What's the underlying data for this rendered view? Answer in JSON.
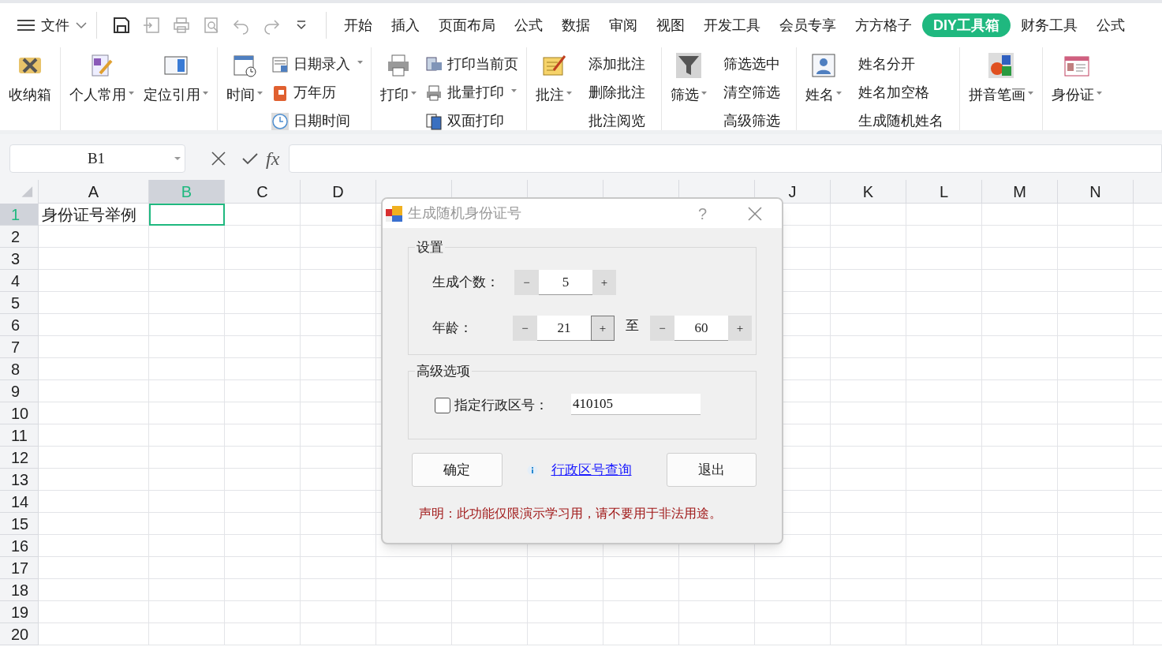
{
  "quick_bar": {
    "file_menu": "文件"
  },
  "menu_tabs": [
    {
      "label": "开始",
      "selected": false
    },
    {
      "label": "插入",
      "selected": false
    },
    {
      "label": "页面布局",
      "selected": false
    },
    {
      "label": "公式",
      "selected": false
    },
    {
      "label": "数据",
      "selected": false
    },
    {
      "label": "审阅",
      "selected": false
    },
    {
      "label": "视图",
      "selected": false
    },
    {
      "label": "开发工具",
      "selected": false
    },
    {
      "label": "会员专享",
      "selected": false
    },
    {
      "label": "方方格子",
      "selected": false
    },
    {
      "label": "DIY工具箱",
      "selected": true
    },
    {
      "label": "财务工具",
      "selected": false
    },
    {
      "label": "公式",
      "selected": false
    }
  ],
  "ribbon": {
    "groups": [
      {
        "items": [
          {
            "kind": "large",
            "label": "收纳箱",
            "dropdown": false
          }
        ]
      },
      {
        "items": [
          {
            "kind": "large",
            "label": "个人常用",
            "dropdown": true
          },
          {
            "kind": "large",
            "label": "定位引用",
            "dropdown": true
          }
        ]
      },
      {
        "items": [
          {
            "kind": "large",
            "label": "时间",
            "dropdown": true
          },
          {
            "kind": "small",
            "label": "日期录入",
            "dropdown": true
          },
          {
            "kind": "small",
            "label": "万年历",
            "dropdown": false
          },
          {
            "kind": "small",
            "label": "日期时间",
            "dropdown": false
          }
        ]
      },
      {
        "items": [
          {
            "kind": "large",
            "label": "打印",
            "dropdown": true
          },
          {
            "kind": "small",
            "label": "打印当前页",
            "dropdown": false
          },
          {
            "kind": "small",
            "label": "批量打印",
            "dropdown": true
          },
          {
            "kind": "small",
            "label": "双面打印",
            "dropdown": false
          }
        ]
      },
      {
        "items": [
          {
            "kind": "large",
            "label": "批注",
            "dropdown": true
          },
          {
            "kind": "text",
            "label": "添加批注",
            "dropdown": false
          },
          {
            "kind": "text",
            "label": "删除批注",
            "dropdown": false
          },
          {
            "kind": "text",
            "label": "批注阅览",
            "dropdown": false
          }
        ]
      },
      {
        "items": [
          {
            "kind": "large",
            "label": "筛选",
            "dropdown": true
          },
          {
            "kind": "text",
            "label": "筛选选中",
            "dropdown": false
          },
          {
            "kind": "text",
            "label": "清空筛选",
            "dropdown": false
          },
          {
            "kind": "text",
            "label": "高级筛选",
            "dropdown": false
          }
        ]
      },
      {
        "items": [
          {
            "kind": "large",
            "label": "姓名",
            "dropdown": true
          },
          {
            "kind": "text",
            "label": "姓名分开",
            "dropdown": false
          },
          {
            "kind": "text",
            "label": "姓名加空格",
            "dropdown": false
          },
          {
            "kind": "text",
            "label": "生成随机姓名",
            "dropdown": false
          }
        ]
      },
      {
        "items": [
          {
            "kind": "large",
            "label": "拼音笔画",
            "dropdown": true
          }
        ]
      },
      {
        "items": [
          {
            "kind": "large",
            "label": "身份证",
            "dropdown": true
          }
        ]
      }
    ]
  },
  "formula_bar": {
    "name_box": "B1",
    "fx": "fx"
  },
  "sheet": {
    "columns": [
      {
        "label": "A",
        "selected": false
      },
      {
        "label": "B",
        "selected": true
      },
      {
        "label": "C",
        "selected": false
      },
      {
        "label": "D",
        "selected": false
      },
      {},
      {},
      {},
      {},
      {},
      {
        "label": "J",
        "selected": false
      },
      {
        "label": "K",
        "selected": false
      },
      {
        "label": "L",
        "selected": false
      },
      {
        "label": "M",
        "selected": false
      },
      {
        "label": "N",
        "selected": false
      }
    ],
    "rows": [
      {
        "label": "1",
        "selected": true,
        "cells": [
          "身份证号举例"
        ]
      },
      {
        "label": "2",
        "selected": false
      },
      {
        "label": "3",
        "selected": false
      },
      {
        "label": "4",
        "selected": false
      },
      {
        "label": "5",
        "selected": false
      },
      {
        "label": "6",
        "selected": false
      },
      {
        "label": "7",
        "selected": false
      },
      {
        "label": "8",
        "selected": false
      },
      {
        "label": "9",
        "selected": false
      },
      {
        "label": "10",
        "selected": false
      },
      {
        "label": "11",
        "selected": false
      },
      {
        "label": "12",
        "selected": false
      },
      {
        "label": "13",
        "selected": false
      },
      {
        "label": "14",
        "selected": false
      },
      {
        "label": "15",
        "selected": false
      },
      {
        "label": "16",
        "selected": false
      },
      {
        "label": "17",
        "selected": false
      },
      {
        "label": "18",
        "selected": false
      },
      {
        "label": "19",
        "selected": false
      },
      {
        "label": "20",
        "selected": false
      }
    ]
  },
  "dialog": {
    "title": "生成随机身份证号",
    "help": "?",
    "settings": {
      "legend": "设置",
      "count": {
        "label": "生成个数：",
        "minus": "−",
        "value": "5",
        "plus": "+"
      },
      "age": {
        "label": "年龄：",
        "separator": "至",
        "from": {
          "minus": "−",
          "value": "21",
          "plus": "+",
          "plus_focused": true
        },
        "to": {
          "minus": "−",
          "value": "60",
          "plus": "+",
          "plus_focused": false
        }
      }
    },
    "advanced": {
      "legend": "高级选项",
      "checkbox": {
        "label": "指定行政区号：",
        "checked": false
      },
      "value": "410105"
    },
    "ok": "确定",
    "link": "行政区号查询",
    "exit": "退出",
    "notice": "声明：此功能仅限演示学习用，请不要用于非法用途。"
  }
}
